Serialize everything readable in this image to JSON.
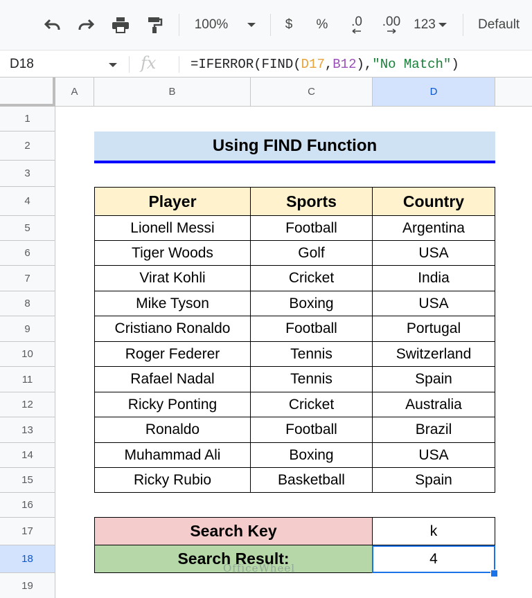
{
  "toolbar": {
    "zoom": "100%",
    "currency": "$",
    "percent": "%",
    "decrease_decimals": ".0",
    "increase_decimals": ".00",
    "number_format": "123",
    "font": "Default"
  },
  "formula_bar": {
    "name_box": "D18",
    "fx": "fx",
    "formula_prefix": "=IFERROR(FIND(",
    "ref1": "D17",
    "comma1": ",",
    "ref2": "B12",
    "mid": "),",
    "string": "\"No Match\"",
    "suffix": ")"
  },
  "columns": [
    "A",
    "B",
    "C",
    "D"
  ],
  "rows": [
    "1",
    "2",
    "3",
    "4",
    "5",
    "6",
    "7",
    "8",
    "9",
    "10",
    "11",
    "12",
    "13",
    "14",
    "15",
    "16",
    "17",
    "18",
    "19"
  ],
  "sheet": {
    "title": "Using FIND Function",
    "headers": [
      "Player",
      "Sports",
      "Country"
    ],
    "records": [
      [
        "Lionell Messi",
        "Football",
        "Argentina"
      ],
      [
        "Tiger Woods",
        "Golf",
        "USA"
      ],
      [
        "Virat Kohli",
        "Cricket",
        "India"
      ],
      [
        "Mike Tyson",
        "Boxing",
        "USA"
      ],
      [
        "Cristiano Ronaldo",
        "Football",
        "Portugal"
      ],
      [
        "Roger Federer",
        "Tennis",
        "Switzerland"
      ],
      [
        "Rafael Nadal",
        "Tennis",
        "Spain"
      ],
      [
        "Ricky Ponting",
        "Cricket",
        "Australia"
      ],
      [
        "Ronaldo",
        "Football",
        "Brazil"
      ],
      [
        "Muhammad Ali",
        "Boxing",
        "USA"
      ],
      [
        "Ricky Rubio",
        "Basketball",
        "Spain"
      ]
    ],
    "search_key_label": "Search Key",
    "search_key_value": "k",
    "search_result_label": "Search Result:",
    "search_result_value": "4"
  },
  "watermark": "OfficeWheel",
  "colors": {
    "title_bg": "#cfe2f3",
    "header_bg": "#fff2cc",
    "search_key_bg": "#f4cccc",
    "search_result_bg": "#b6d7a8",
    "selection": "#1a73e8"
  }
}
